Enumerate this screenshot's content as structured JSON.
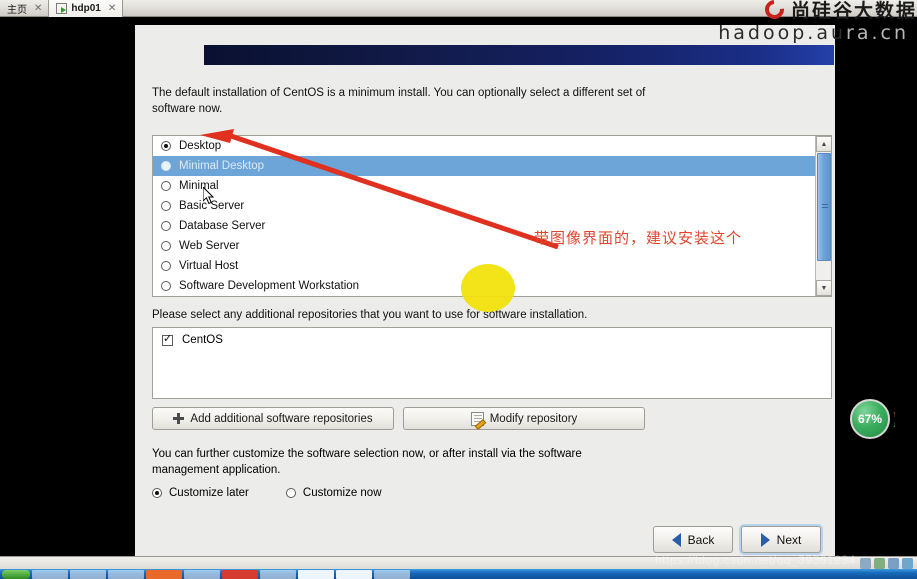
{
  "window": {
    "tabs": [
      {
        "label": "主页",
        "active": false,
        "icon": "home-tab-icon"
      },
      {
        "label": "hdp01",
        "active": true,
        "icon": "vm-power-icon"
      }
    ],
    "close_glyph": "✕"
  },
  "dialog": {
    "intro": "The default installation of CentOS is a minimum install. You can optionally select a different set of software now.",
    "software_sets": [
      {
        "label": "Desktop",
        "selected": true,
        "highlighted": false
      },
      {
        "label": "Minimal Desktop",
        "selected": false,
        "highlighted": true
      },
      {
        "label": "Minimal",
        "selected": false,
        "highlighted": false
      },
      {
        "label": "Basic Server",
        "selected": false,
        "highlighted": false
      },
      {
        "label": "Database Server",
        "selected": false,
        "highlighted": false
      },
      {
        "label": "Web Server",
        "selected": false,
        "highlighted": false
      },
      {
        "label": "Virtual Host",
        "selected": false,
        "highlighted": false
      },
      {
        "label": "Software Development Workstation",
        "selected": false,
        "highlighted": false
      }
    ],
    "repo_label": "Please select any additional repositories that you want to use for software installation.",
    "repositories": [
      {
        "label": "CentOS",
        "checked": true
      }
    ],
    "add_repo_button": "Add additional software repositories",
    "modify_repo_button": "Modify repository",
    "customize_note": "You can further customize the software selection now, or after install via the software management application.",
    "customize_options": [
      {
        "label": "Customize later",
        "selected": true
      },
      {
        "label": "Customize now",
        "selected": false
      }
    ],
    "back_button": "Back",
    "next_button": "Next"
  },
  "annotations": {
    "chinese_note": "带图像界面的，建议安装这个",
    "arrow_color": "#e03020",
    "circle_color": "#f2e208"
  },
  "watermark": {
    "logo_text": "尚硅谷大数据",
    "url_main": "hadoop.au",
    "url_tail": "ra.cn",
    "bottom_url": "https://blog.csdn.net/qq_39361234"
  },
  "badge": {
    "percent": "67%",
    "up_glyph": "↑",
    "down_glyph": "↓"
  },
  "scrollbar": {
    "up_glyph": "▲",
    "down_glyph": "▼"
  }
}
